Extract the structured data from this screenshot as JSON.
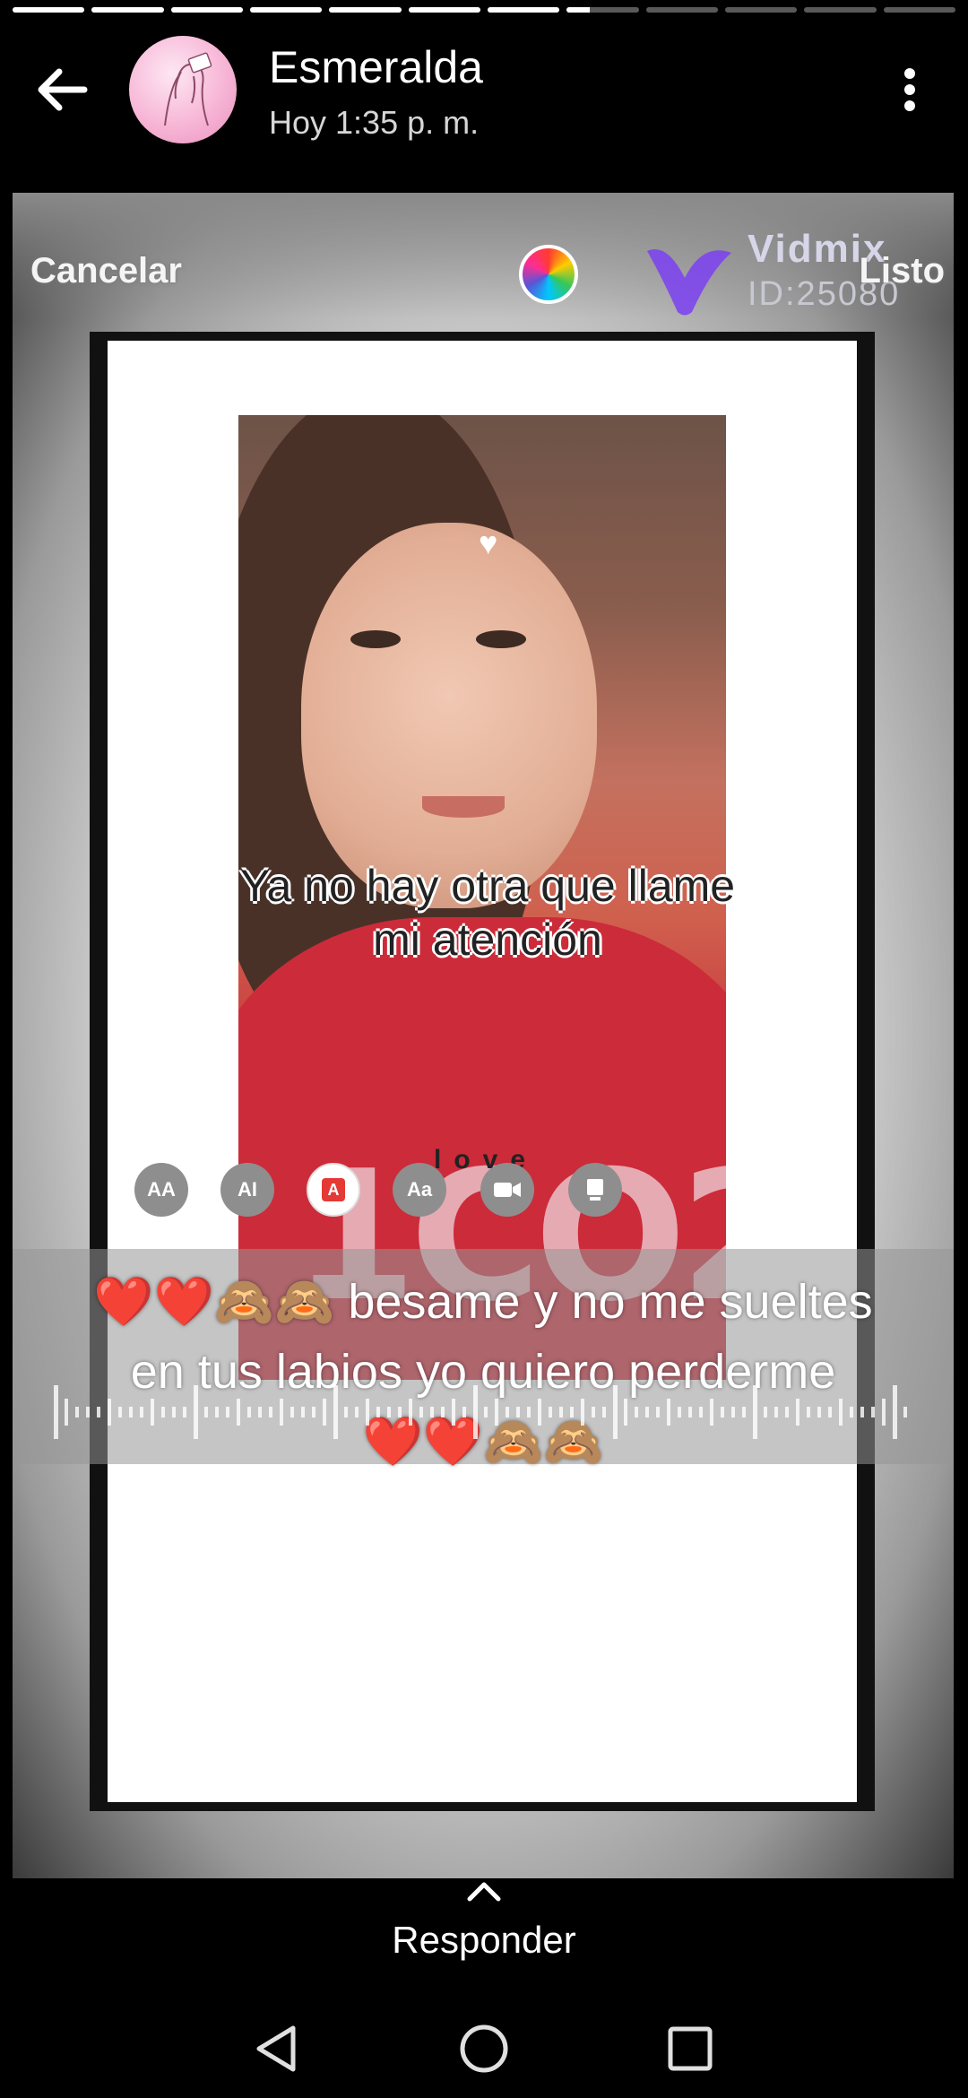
{
  "progress": {
    "segments": [
      1,
      1,
      1,
      1,
      1,
      1,
      1,
      0.32,
      0,
      0,
      0,
      0
    ]
  },
  "header": {
    "name": "Esmeralda",
    "time": "Hoy 1:35 p. m."
  },
  "story": {
    "cancel_label": "Cancelar",
    "done_label": "Listo",
    "watermark_brand": "Vidmix",
    "watermark_id": "ID:25080",
    "overlay_line1": "Ya no hay otra que llame",
    "overlay_line2": "mi atención",
    "love_label": "love",
    "tools": [
      "AA",
      "AI",
      "A",
      "Aa",
      "video",
      "device"
    ],
    "caption_line1": "❤️❤️🙈🙈 besame y no me sueltes",
    "caption_line2": "en tus labios yo quiero perderme",
    "caption_line3": "❤️❤️🙈🙈"
  },
  "footer": {
    "reply_label": "Responder"
  },
  "colors": {
    "background": "#000000",
    "shirt": "#cc2b3a",
    "vidmix_purple": "#7b3ff2"
  }
}
